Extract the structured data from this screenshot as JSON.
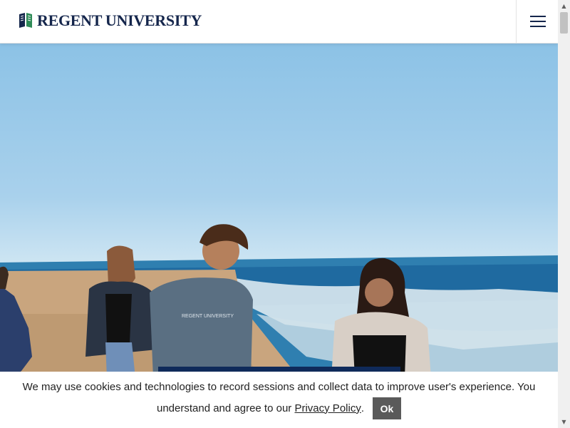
{
  "header": {
    "logo_text": "REGENT UNIVERSITY",
    "menu_icon": "hamburger-menu-icon"
  },
  "hero": {
    "shirt_text": "REGENT UNIVERSITY"
  },
  "cookie_banner": {
    "line1": "We may use cookies and technologies to record sessions and collect data to improve user's experience. You",
    "line2_prefix": "understand and agree to our ",
    "policy_link": "Privacy Policy",
    "line2_suffix": ".",
    "ok_label": "Ok"
  },
  "scrollbar": {
    "up_icon": "scroll-up-arrow-icon",
    "down_icon": "scroll-down-arrow-icon"
  },
  "colors": {
    "brand_navy": "#15264c",
    "brand_green": "#2e8b57",
    "ok_button": "#5a5a5a"
  }
}
